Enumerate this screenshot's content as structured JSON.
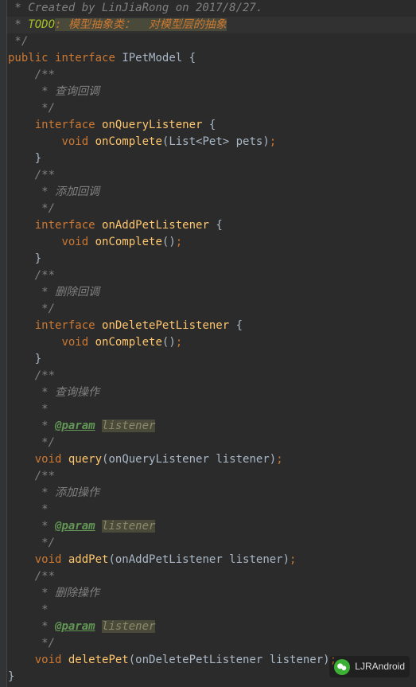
{
  "lines": {
    "l1": " * Created by LinJiaRong on 2017/8/27.",
    "l2a": " * ",
    "l2b": "TODO",
    "l2c": ": 模型抽象类：  对模型层的抽象",
    "l3": " */",
    "l4a": "public",
    "l4b": "interface",
    "l4c": "IPetModel",
    "l4d": "{",
    "l5": "    /**",
    "l6": "     * 查询回调",
    "l7": "     */",
    "l8a": "    ",
    "l8b": "interface",
    "l8c": "onQueryListener",
    "l8d": "{",
    "l9a": "        ",
    "l9b": "void",
    "l9c": "onComplete",
    "l9d": "(List<Pet> pets)",
    "l9e": ";",
    "l10": "    }",
    "l11": "    /**",
    "l12": "     * 添加回调",
    "l13": "     */",
    "l14a": "    ",
    "l14b": "interface",
    "l14c": "onAddPetListener",
    "l14d": "{",
    "l15a": "        ",
    "l15b": "void",
    "l15c": "onComplete",
    "l15d": "()",
    "l15e": ";",
    "l16": "    }",
    "l17": "    /**",
    "l18": "     * 删除回调",
    "l19": "     */",
    "l20a": "    ",
    "l20b": "interface",
    "l20c": "onDeletePetListener",
    "l20d": "{",
    "l21a": "        ",
    "l21b": "void",
    "l21c": "onComplete",
    "l21d": "()",
    "l21e": ";",
    "l22": "    }",
    "l23": "    /**",
    "l24": "     * 查询操作",
    "l25": "     *",
    "l26a": "     * ",
    "l26b": "@param",
    "l26c": "listener",
    "l27": "     */",
    "l28a": "    ",
    "l28b": "void",
    "l28c": "query",
    "l28d": "(onQueryListener listener)",
    "l28e": ";",
    "l29": "    /**",
    "l30": "     * 添加操作",
    "l31": "     *",
    "l32a": "     * ",
    "l32b": "@param",
    "l32c": "listener",
    "l33": "     */",
    "l34a": "    ",
    "l34b": "void",
    "l34c": "addPet",
    "l34d": "(onAddPetListener listener)",
    "l34e": ";",
    "l35": "    /**",
    "l36": "     * 删除操作",
    "l37": "     *",
    "l38a": "     * ",
    "l38b": "@param",
    "l38c": "listener",
    "l39": "     */",
    "l40a": "    ",
    "l40b": "void",
    "l40c": "deletePet",
    "l40d": "(onDeletePetListener listener)",
    "l40e": ";",
    "l41": "}"
  },
  "watermark": {
    "text": "LJRAndroid"
  }
}
